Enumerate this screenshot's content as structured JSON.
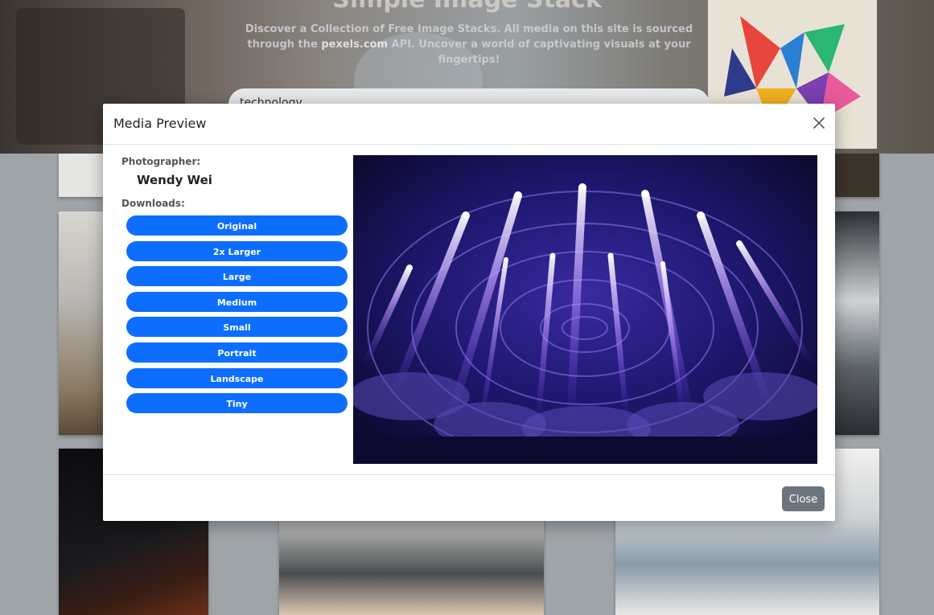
{
  "hero": {
    "title": "Simple Image Stack",
    "description_pre": "Discover a Collection of Free Image Stacks. All media on this site is sourced through the",
    "description_link": "pexels.com",
    "description_post": "API. Uncover a world of captivating visuals at your fingertips!",
    "search_value": "technology"
  },
  "modal": {
    "title": "Media Preview",
    "photographer_label": "Photographer:",
    "photographer_name": "Wendy Wei",
    "downloads_label": "Downloads:",
    "downloads": [
      "Original",
      "2x Larger",
      "Large",
      "Medium",
      "Small",
      "Portrait",
      "Landscape",
      "Tiny"
    ],
    "close_label": "Close"
  },
  "colors": {
    "primary": "#0d6efd",
    "secondary": "#6c757d"
  }
}
